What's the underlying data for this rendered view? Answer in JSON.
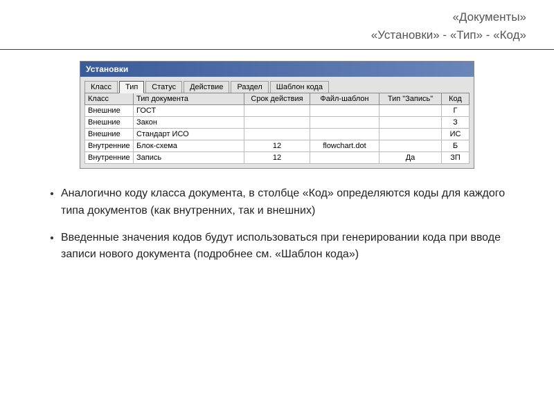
{
  "header": {
    "line1": "«Документы»",
    "line2": "«Установки» - «Тип» - «Код»"
  },
  "window": {
    "title": "Установки",
    "tabs": [
      "Класс",
      "Тип",
      "Статус",
      "Действие",
      "Раздел",
      "Шаблон кода"
    ],
    "active_tab": 1,
    "columns": [
      "Класс",
      "Тип документа",
      "Срок действия",
      "Файл-шаблон",
      "Тип \"Запись\"",
      "Код"
    ],
    "rows": [
      {
        "class": "Внешние",
        "doctype": "ГОСТ",
        "srok": "",
        "file": "",
        "tipz": "",
        "kod": "Г"
      },
      {
        "class": "Внешние",
        "doctype": "Закон",
        "srok": "",
        "file": "",
        "tipz": "",
        "kod": "З"
      },
      {
        "class": "Внешние",
        "doctype": "Стандарт ИСО",
        "srok": "",
        "file": "",
        "tipz": "",
        "kod": "ИС"
      },
      {
        "class": "Внутренние",
        "doctype": "Блок-схема",
        "srok": "12",
        "file": "flowchart.dot",
        "tipz": "",
        "kod": "Б"
      },
      {
        "class": "Внутренние",
        "doctype": "Запись",
        "srok": "12",
        "file": "",
        "tipz": "Да",
        "kod": "ЗП"
      }
    ]
  },
  "bullets": [
    "Аналогично коду класса документа, в столбце «Код» определяются коды для каждого типа документов (как внутренних, так и внешних)",
    "Введенные значения кодов будут использоваться при генерировании кода при вводе записи нового документа (подробнее см. «Шаблон кода»)"
  ]
}
